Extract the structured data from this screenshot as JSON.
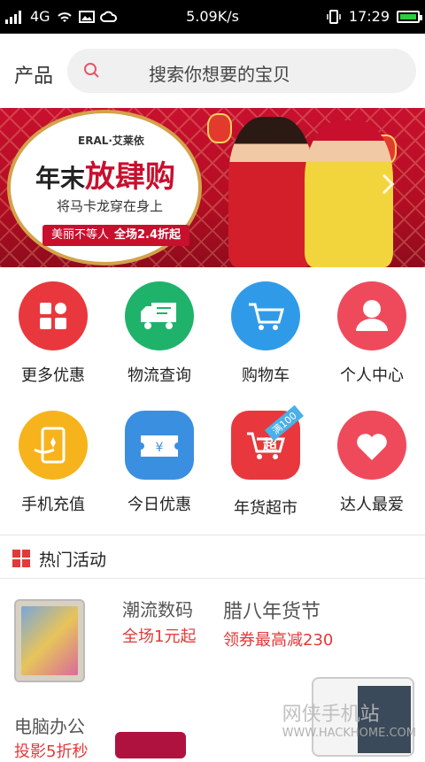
{
  "status_bar": {
    "network": "4G",
    "speed": "5.09K/s",
    "time": "17:29"
  },
  "search": {
    "category_label": "产品",
    "placeholder": "搜索你想要的宝贝"
  },
  "banner": {
    "brand": "ERAL·艾莱依",
    "slogan_prefix": "年末",
    "slogan_main": "放肆购",
    "subtitle": "将马卡龙穿在身上",
    "tag_text": "美丽不等人",
    "tag_offer": "全场2.4折起"
  },
  "grid": [
    {
      "label": "更多优惠",
      "icon": "grid-icon",
      "color": "#e8383d"
    },
    {
      "label": "物流查询",
      "icon": "truck-icon",
      "color": "#1fb26b"
    },
    {
      "label": "购物车",
      "icon": "cart-icon",
      "color": "#2f9be8"
    },
    {
      "label": "个人中心",
      "icon": "person-icon",
      "color": "#ef4a5c"
    },
    {
      "label": "手机充值",
      "icon": "phone-icon",
      "color": "#f6b31b"
    },
    {
      "label": "今日优惠",
      "icon": "ticket-icon",
      "color": "#3b8fe0"
    },
    {
      "label": "年货超市",
      "icon": "supermarket-icon",
      "color": "#e8383d",
      "badge": "满100",
      "glyph": "超"
    },
    {
      "label": "达人最爱",
      "icon": "heart-icon",
      "color": "#ef4a5c"
    }
  ],
  "hot": {
    "title": "热门活动",
    "items": [
      {
        "title": "潮流数码",
        "subtitle": "全场1元起"
      },
      {
        "title": "腊八年货节",
        "subtitle": "领券最高减230"
      },
      {
        "title": "电脑办公",
        "subtitle": "投影5折秒"
      }
    ]
  },
  "watermark": {
    "name": "网侠手机站",
    "url": "WWW.HACKHOME.COM"
  }
}
